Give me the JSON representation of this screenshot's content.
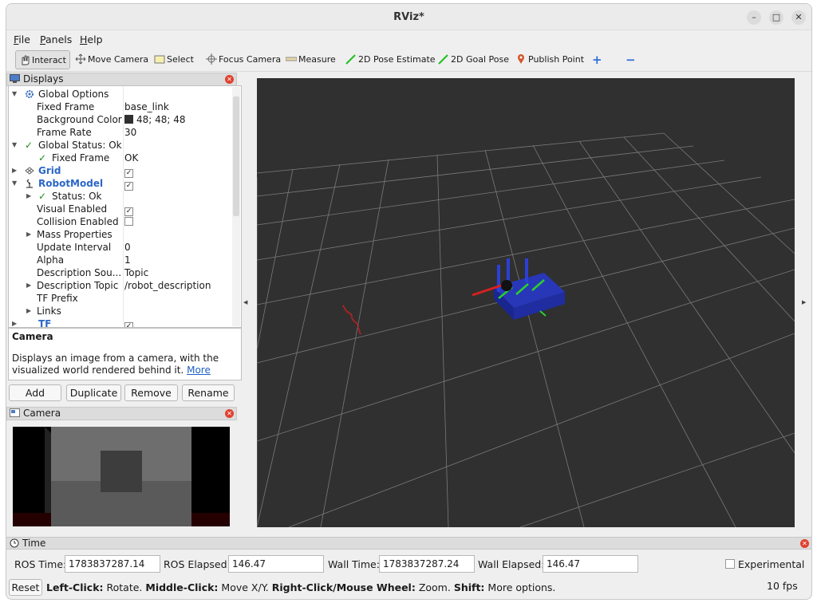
{
  "window": {
    "title": "RViz*",
    "minimize": "–",
    "maximize": "□",
    "close": "✕"
  },
  "menu": [
    {
      "label": "File",
      "u": "F",
      "rest": "ile"
    },
    {
      "label": "Panels",
      "u": "P",
      "rest": "anels"
    },
    {
      "label": "Help",
      "u": "H",
      "rest": "elp"
    }
  ],
  "toolbar": {
    "interact": "Interact",
    "move_camera": "Move Camera",
    "select": "Select",
    "focus_camera": "Focus Camera",
    "measure": "Measure",
    "pose_estimate": "2D Pose Estimate",
    "goal_pose": "2D Goal Pose",
    "publish_point": "Publish Point",
    "add_tool": "+",
    "remove_tool": "−"
  },
  "displays_panel": {
    "title": "Displays",
    "rows": {
      "global_options": "Global Options",
      "fixed_frame_label": "Fixed Frame",
      "fixed_frame_value": "base_link",
      "bg_color_label": "Background Color",
      "bg_color_value": "48; 48; 48",
      "frame_rate_label": "Frame Rate",
      "frame_rate_value": "30",
      "global_status": "Global Status: Ok",
      "status_fixed_frame_label": "Fixed Frame",
      "status_fixed_frame_value": "OK",
      "grid": "Grid",
      "robot_model": "RobotModel",
      "status_ok": "Status: Ok",
      "visual_enabled": "Visual Enabled",
      "collision_enabled": "Collision Enabled",
      "mass_properties": "Mass Properties",
      "update_interval_label": "Update Interval",
      "update_interval_value": "0",
      "alpha_label": "Alpha",
      "alpha_value": "1",
      "desc_source_label": "Description Sou...",
      "desc_source_value": "Topic",
      "desc_topic_label": "Description Topic",
      "desc_topic_value": "/robot_description",
      "tf_prefix": "TF Prefix",
      "links": "Links",
      "tf": "TF"
    },
    "checks": {
      "grid": "✓",
      "robot_model": "✓",
      "visual_enabled": "✓",
      "collision_enabled": "",
      "tf": "✓"
    },
    "check_mark": "✓",
    "bg_color_hex": "#303030"
  },
  "description": {
    "title": "Camera",
    "text": "Displays an image from a camera, with the visualized world rendered behind it.",
    "more_link": "More"
  },
  "buttons": {
    "add": "Add",
    "duplicate": "Duplicate",
    "remove": "Remove",
    "rename": "Rename"
  },
  "camera_panel": {
    "title": "Camera"
  },
  "time_panel": {
    "title": "Time",
    "ros_time_label": "ROS Time:",
    "ros_time_value": "1783837287.14",
    "ros_elapsed_label": "ROS Elapsed:",
    "ros_elapsed_value": "146.47",
    "wall_time_label": "Wall Time:",
    "wall_time_value": "1783837287.24",
    "wall_elapsed_label": "Wall Elapsed:",
    "wall_elapsed_value": "146.47",
    "experimental_label": "Experimental"
  },
  "status": {
    "reset": "Reset",
    "left_click_key": "Left-Click:",
    "left_click_text": "Rotate.",
    "middle_click_key": "Middle-Click:",
    "middle_click_text": "Move X/Y.",
    "right_click_key": "Right-Click/Mouse Wheel:",
    "right_click_text": "Zoom.",
    "shift_key": "Shift:",
    "shift_text": "More options.",
    "fps": "10 fps"
  }
}
